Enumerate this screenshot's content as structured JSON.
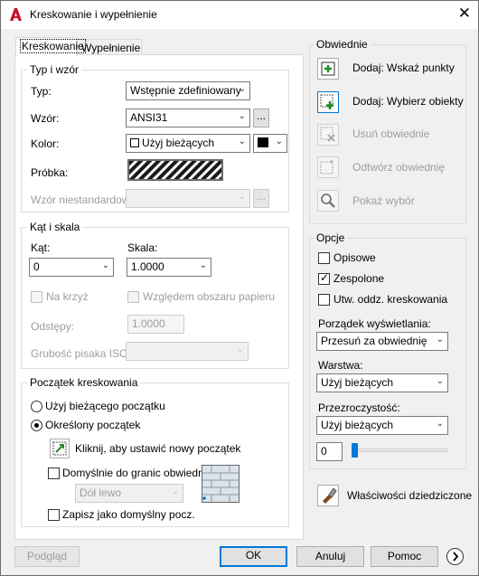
{
  "window": {
    "title": "Kreskowanie i wypełnienie"
  },
  "tabs": [
    {
      "label": "Kreskowanie"
    },
    {
      "label": "Wypełnienie"
    }
  ],
  "type_pattern": {
    "group_title": "Typ i wzór",
    "type_label": "Typ:",
    "type_value": "Wstępnie zdefiniowany",
    "pattern_label": "Wzór:",
    "pattern_value": "ANSI31",
    "browse_label": "...",
    "color_label": "Kolor:",
    "color_value": "Użyj bieżących",
    "color_swatch": "#000000",
    "sample_label": "Próbka:",
    "custom_label": "Wzór niestandardowy:",
    "custom_value": "",
    "custom_browse_label": "..."
  },
  "angle_scale": {
    "group_title": "Kąt i skala",
    "angle_label": "Kąt:",
    "angle_value": "0",
    "scale_label": "Skala:",
    "scale_value": "1.0000",
    "double_label": "Na krzyż",
    "relative_label": "Względem obszaru papieru",
    "spacing_label": "Odstępy:",
    "spacing_value": "1.0000",
    "iso_label": "Grubość pisaka ISO:",
    "iso_value": ""
  },
  "origin": {
    "group_title": "Początek kreskowania",
    "current_label": "Użyj bieżącego początku",
    "specified_label": "Określony początek",
    "click_label": "Kliknij, aby ustawić nowy początek",
    "default_extents_label": "Domyślnie do granic obwiedni",
    "position_value": "Dół lewo",
    "store_label": "Zapisz jako domyślny pocz."
  },
  "boundaries": {
    "group_title": "Obwiednie",
    "add_pick_label": "Dodaj: Wskaż punkty",
    "add_select_label": "Dodaj: Wybierz obiekty",
    "remove_label": "Usuń obwiednie",
    "recreate_label": "Odtwórz obwiednię",
    "view_label": "Pokaż wybór"
  },
  "options": {
    "group_title": "Opcje",
    "annotative_label": "Opisowe",
    "associative_label": "Zespolone",
    "associative_checked": true,
    "separate_label": "Utw. oddz. kreskowania",
    "draw_order_label": "Porządek wyświetlania:",
    "draw_order_value": "Przesuń za obwiednię",
    "layer_label": "Warstwa:",
    "layer_value": "Użyj bieżących",
    "transparency_label": "Przezroczystość:",
    "transparency_value": "Użyj bieżących",
    "transparency_number": "0",
    "transparency_level": 0
  },
  "inherit_label": "Właściwości dziedziczone",
  "footer": {
    "preview_label": "Podgląd",
    "ok_label": "OK",
    "cancel_label": "Anuluj",
    "help_label": "Pomoc"
  },
  "colors": {
    "accent": "#0078d7",
    "app_icon": "#c8102e"
  }
}
